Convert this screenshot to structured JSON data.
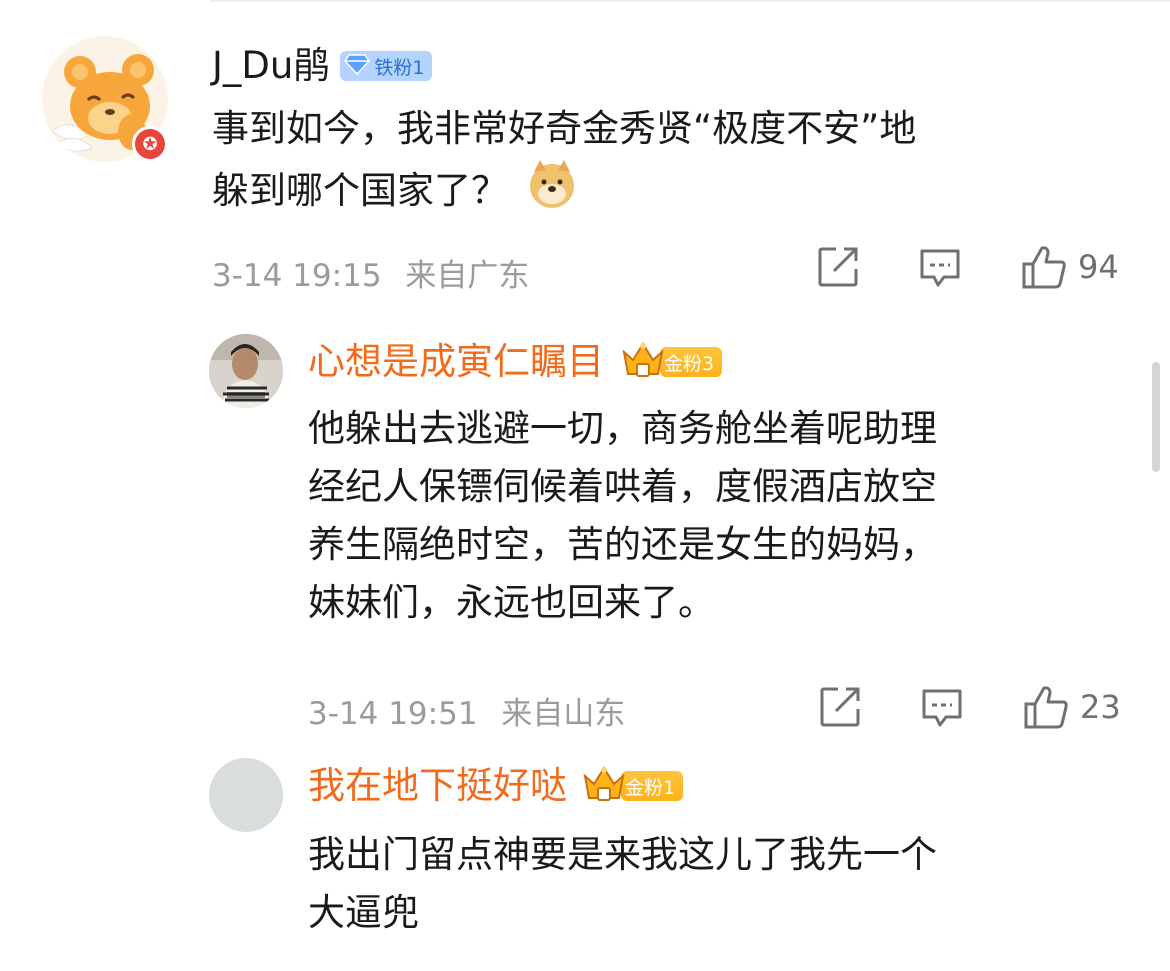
{
  "comments": [
    {
      "username": "J_Du鹃",
      "badge": "铁粉1",
      "lines": [
        "事到如今，我非常好奇金秀贤“极度不安”地",
        "躲到哪个国家了？"
      ],
      "emoji": "doge-emoji",
      "timestamp": "3-14 19:15",
      "location": "来自广东",
      "likes": "94"
    }
  ],
  "replies": [
    {
      "username": "心想是成寅仁瞩目",
      "badge": "金粉3",
      "lines": [
        "他躲出去逃避一切，商务舱坐着呢助理",
        "经纪人保镖伺候着哄着，度假酒店放空",
        "养生隔绝时空，苦的还是女生的妈妈，",
        "妹妹们，永远也回来了。"
      ],
      "timestamp": "3-14 19:51",
      "location": "来自山东",
      "likes": "23"
    },
    {
      "username": "我在地下挺好哒",
      "badge": "金粉1",
      "lines": [
        "我出门留点神要是来我这儿了我先一个",
        "大逼兜"
      ]
    }
  ],
  "colors": {
    "username_orange": "#f26b1d",
    "meta_gray": "#9b9b9b",
    "iron_badge": "#b4d4ff",
    "gold_badge": "#ffb21a"
  }
}
